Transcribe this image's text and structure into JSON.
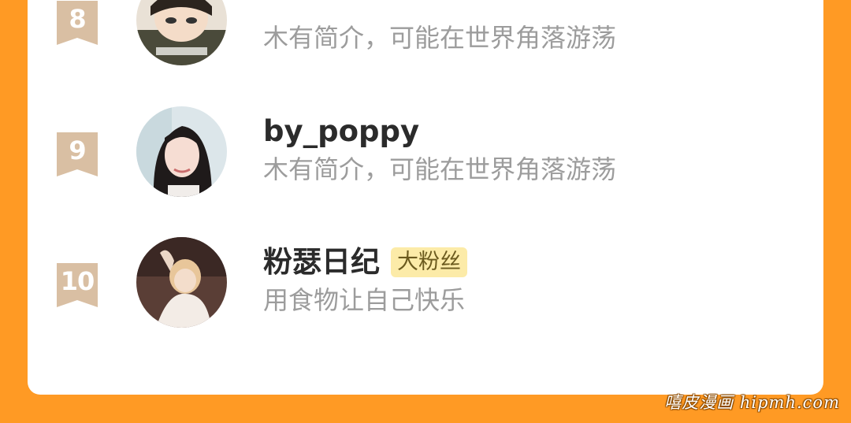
{
  "ranking": {
    "items": [
      {
        "rank": "8",
        "name": "",
        "bio": "木有简介，可能在世界角落游荡",
        "tag": ""
      },
      {
        "rank": "9",
        "name": "by_poppy",
        "bio": "木有简介，可能在世界角落游荡",
        "tag": ""
      },
      {
        "rank": "10",
        "name": "粉瑟日纪",
        "bio": "用食物让自己快乐",
        "tag": "大粉丝"
      }
    ]
  },
  "watermark": "嘻皮漫画 hipmh.com",
  "colors": {
    "background": "#FF9A24",
    "card": "#FFFFFF",
    "rank_badge": "#D9BFA3",
    "username": "#2B2B2B",
    "bio": "#9C9C9C",
    "tag_bg": "#FCEBA8",
    "tag_text": "#6B5A1E"
  }
}
